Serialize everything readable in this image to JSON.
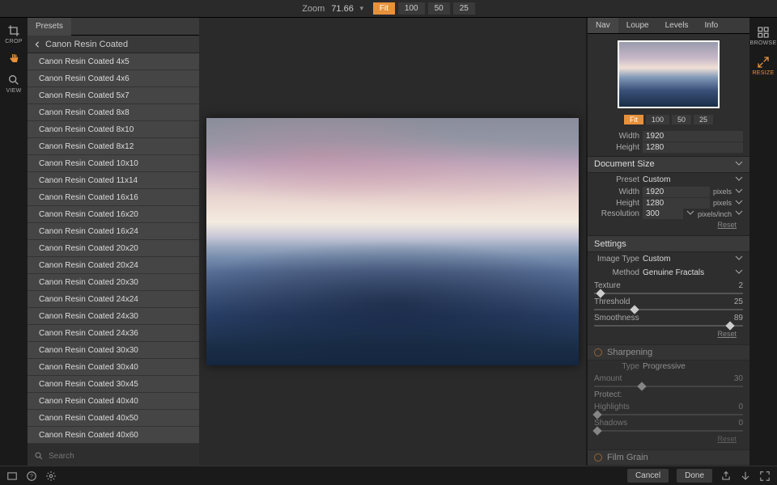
{
  "topbar": {
    "zoom_label": "Zoom",
    "zoom_value": "71.66",
    "buttons": [
      "Fit",
      "100",
      "50",
      "25"
    ],
    "active": "Fit"
  },
  "left_tools": [
    {
      "name": "crop",
      "label": "CROP"
    },
    {
      "name": "pan",
      "label": ""
    },
    {
      "name": "view",
      "label": "VIEW"
    }
  ],
  "presets": {
    "tab": "Presets",
    "header": "Canon Resin Coated",
    "items": [
      "Canon Resin Coated 4x5",
      "Canon Resin Coated 4x6",
      "Canon Resin Coated 5x7",
      "Canon Resin Coated 8x8",
      "Canon Resin Coated 8x10",
      "Canon Resin Coated 8x12",
      "Canon Resin Coated 10x10",
      "Canon Resin Coated 11x14",
      "Canon Resin Coated 16x16",
      "Canon Resin Coated 16x20",
      "Canon Resin Coated 16x24",
      "Canon Resin Coated 20x20",
      "Canon Resin Coated 20x24",
      "Canon Resin Coated 20x30",
      "Canon Resin Coated 24x24",
      "Canon Resin Coated 24x30",
      "Canon Resin Coated 24x36",
      "Canon Resin Coated 30x30",
      "Canon Resin Coated 30x40",
      "Canon Resin Coated 30x45",
      "Canon Resin Coated 40x40",
      "Canon Resin Coated 40x50",
      "Canon Resin Coated 40x60"
    ],
    "search_placeholder": "Search"
  },
  "right_tabs": [
    "Nav",
    "Loupe",
    "Levels",
    "Info"
  ],
  "right_tabs_active": "Nav",
  "right_zoom": [
    "Fit",
    "100",
    "50",
    "25"
  ],
  "nav_dims": {
    "width_label": "Width",
    "width": "1920",
    "height_label": "Height",
    "height": "1280"
  },
  "doc_size": {
    "title": "Document Size",
    "preset_label": "Preset",
    "preset": "Custom",
    "width_label": "Width",
    "width": "1920",
    "width_unit": "pixels",
    "height_label": "Height",
    "height": "1280",
    "height_unit": "pixels",
    "res_label": "Resolution",
    "res": "300",
    "res_unit": "pixels/inch",
    "reset": "Reset"
  },
  "settings": {
    "title": "Settings",
    "imgtype_label": "Image Type",
    "imgtype": "Custom",
    "method_label": "Method",
    "method": "Genuine Fractals",
    "sliders": [
      {
        "name": "Texture",
        "value": "2",
        "pct": 2
      },
      {
        "name": "Threshold",
        "value": "25",
        "pct": 25
      },
      {
        "name": "Smoothness",
        "value": "89",
        "pct": 89
      }
    ],
    "reset": "Reset"
  },
  "sharpening": {
    "title": "Sharpening",
    "type_label": "Type",
    "type": "Progressive",
    "amount_label": "Amount",
    "amount": "30",
    "amount_pct": 30,
    "protect": "Protect:",
    "highlights_label": "Highlights",
    "highlights": "0",
    "shadows_label": "Shadows",
    "shadows": "0",
    "reset": "Reset"
  },
  "film_grain": {
    "title": "Film Grain"
  },
  "right_tools": [
    {
      "name": "browse",
      "label": "BROWSE"
    },
    {
      "name": "resize",
      "label": "RESIZE",
      "active": true
    }
  ],
  "bottom": {
    "cancel": "Cancel",
    "done": "Done"
  }
}
